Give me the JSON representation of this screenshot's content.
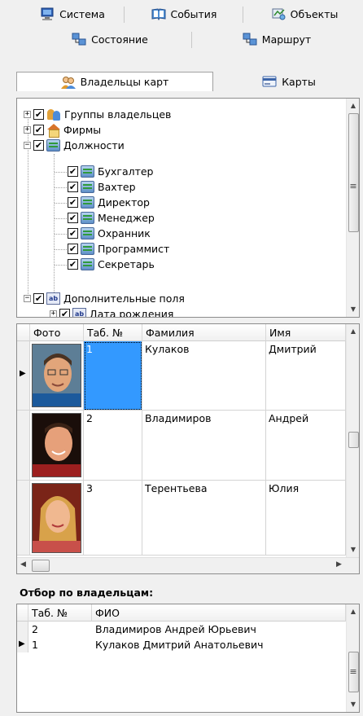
{
  "tabs_row1": [
    {
      "label": "Система",
      "icon": "computer-icon"
    },
    {
      "label": "События",
      "icon": "book-icon"
    },
    {
      "label": "Объекты",
      "icon": "objects-icon"
    }
  ],
  "tabs_row2": [
    {
      "label": "Состояние",
      "icon": "network-icon"
    },
    {
      "label": "Маршрут",
      "icon": "route-icon"
    }
  ],
  "tabs_row3": [
    {
      "label": "Владельцы карт",
      "icon": "people-icon",
      "active": true
    },
    {
      "label": "Карты",
      "icon": "cards-icon"
    }
  ],
  "tree": {
    "items": [
      {
        "label": "Группы владельцев",
        "checked": true,
        "expander": "+"
      },
      {
        "label": "Фирмы",
        "checked": true,
        "expander": "+"
      },
      {
        "label": "Должности",
        "checked": true,
        "expander": "−"
      },
      {
        "label": "Бухгалтер",
        "checked": true
      },
      {
        "label": "Вахтер",
        "checked": true
      },
      {
        "label": "Директор",
        "checked": true
      },
      {
        "label": "Менеджер",
        "checked": true
      },
      {
        "label": "Охранник",
        "checked": true
      },
      {
        "label": "Программист",
        "checked": true
      },
      {
        "label": "Секретарь",
        "checked": true
      },
      {
        "label": "Дополнительные поля",
        "checked": true,
        "expander": "−"
      },
      {
        "label": "Дата рождения",
        "checked": true,
        "expander": "+"
      }
    ],
    "check_mark": "✔"
  },
  "owners_grid": {
    "columns": [
      "Фото",
      "Таб. №",
      "Фамилия",
      "Имя"
    ],
    "rows": [
      {
        "tab": "1",
        "surname": "Кулаков",
        "name": "Дмитрий",
        "selected": true
      },
      {
        "tab": "2",
        "surname": "Владимиров",
        "name": "Андрей"
      },
      {
        "tab": "3",
        "surname": "Терентьева",
        "name": "Юлия"
      }
    ]
  },
  "filter": {
    "title": "Отбор по владельцам:",
    "columns": [
      "Таб. №",
      "ФИО"
    ],
    "rows": [
      {
        "tab": "2",
        "fio": "Владимиров Андрей Юрьевич"
      },
      {
        "tab": "1",
        "fio": "Кулаков Дмитрий Анатольевич",
        "current": true
      }
    ]
  },
  "colors": {
    "selection": "#3399ff",
    "panel_border": "#8c8c8c"
  }
}
